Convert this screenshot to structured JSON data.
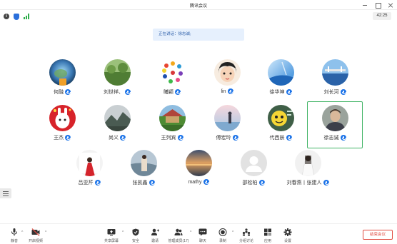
{
  "window": {
    "title": "腾讯会议"
  },
  "topbar": {
    "timer": "42:25"
  },
  "speaking_label": "正在讲话：徐志诚;",
  "participants": [
    {
      "name": "何融",
      "mic": "mic-on"
    },
    {
      "name": "刘世祥、",
      "mic": "mic-on"
    },
    {
      "name": "曦颖",
      "mic": "mic-on"
    },
    {
      "name": "lin",
      "mic": "mic-on"
    },
    {
      "name": "徐华坤",
      "mic": "mic-on"
    },
    {
      "name": "刘长河",
      "mic": "mic-on"
    },
    {
      "name": "王杰",
      "mic": "mic-on"
    },
    {
      "name": "尚义",
      "mic": "mic-on"
    },
    {
      "name": "王列宾",
      "mic": "mic-on"
    },
    {
      "name": "傅宏玲",
      "mic": "mic-on"
    },
    {
      "name": "代西辰",
      "mic": "mic-on"
    },
    {
      "name": "徐志诚",
      "mic": "mic-on"
    },
    {
      "name": "吕亚芹",
      "mic": "mic-on"
    },
    {
      "name": "张凯鑫",
      "mic": "mic-on"
    },
    {
      "name": "mathy",
      "mic": "mic-on"
    },
    {
      "name": "邵松柏",
      "mic": "mic-on"
    },
    {
      "name": "刘春燕丨张建人",
      "mic": "mic-on"
    }
  ],
  "toolbar": {
    "mute": "静音",
    "video": "开启视频",
    "share": "共享屏幕",
    "security": "安全",
    "invite": "邀请",
    "members": "管理成员(17)",
    "chat": "聊天",
    "record": "录制",
    "breakout": "分组讨论",
    "apps": "应用",
    "settings": "设置",
    "end": "结束会议"
  },
  "colors": {
    "accent": "#1b73e8",
    "active_border": "#3fb364",
    "end": "#e04a3f"
  }
}
